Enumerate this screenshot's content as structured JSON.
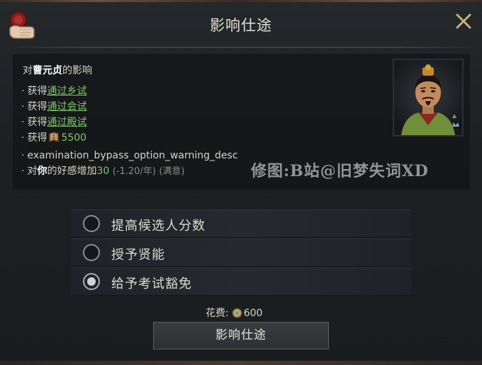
{
  "dialog": {
    "title": "影响仕途",
    "heading_prefix": "对",
    "heading_name": "曹元贞",
    "heading_suffix": "的影响",
    "effects": [
      {
        "prefix": "获得",
        "link": "通过乡试"
      },
      {
        "prefix": "获得",
        "link": "通过会试"
      },
      {
        "prefix": "获得",
        "link": "通过殿试"
      },
      {
        "prefix": "获得",
        "value": "5500",
        "icon": "book-icon"
      },
      {
        "text": "examination_bypass_option_warning_desc"
      },
      {
        "prefix_a": "对",
        "bold": "你",
        "prefix_b": "的好感增加",
        "value": "30",
        "rate": "(-1.20/年)",
        "status": "(满意)"
      }
    ],
    "watermark": "修图:B站@旧梦失词XD",
    "options": [
      {
        "label": "提高候选人分数",
        "selected": false
      },
      {
        "label": "授予贤能",
        "selected": false
      },
      {
        "label": "给予考试豁免",
        "selected": true
      }
    ],
    "cost_label": "花费:",
    "cost_value": "600",
    "confirm_label": "影响仕途"
  },
  "colors": {
    "positive": "#7dc86a",
    "background": "#1b1e21",
    "text": "#d8d3c6"
  }
}
